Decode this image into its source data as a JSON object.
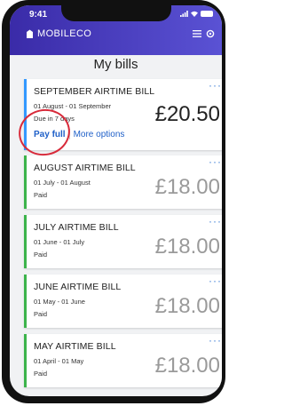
{
  "status_bar": {
    "time": "9:41"
  },
  "header": {
    "brand": "MOBILECO",
    "accent": "#4a3fc4"
  },
  "page": {
    "title": "My bills"
  },
  "bills": [
    {
      "title": "SEPTEMBER AIRTIME BILL",
      "dates": "01 August - 01 September",
      "status": "Due in 7 days",
      "amount": "£20.50",
      "more": "···",
      "actions": {
        "pay_full": "Pay full",
        "more_options": "More options"
      }
    },
    {
      "title": "AUGUST AIRTIME BILL",
      "dates": "01 July - 01 August",
      "status": "Paid",
      "amount": "£18.00",
      "more": "···"
    },
    {
      "title": "JULY AIRTIME BILL",
      "dates": "01 June - 01 July",
      "status": "Paid",
      "amount": "£18.00",
      "more": "···"
    },
    {
      "title": "JUNE AIRTIME BILL",
      "dates": "01 May - 01 June",
      "status": "Paid",
      "amount": "£18.00",
      "more": "···"
    },
    {
      "title": "MAY AIRTIME BILL",
      "dates": "01 April - 01 May",
      "status": "Paid",
      "amount": "£18.00",
      "more": "···"
    }
  ]
}
